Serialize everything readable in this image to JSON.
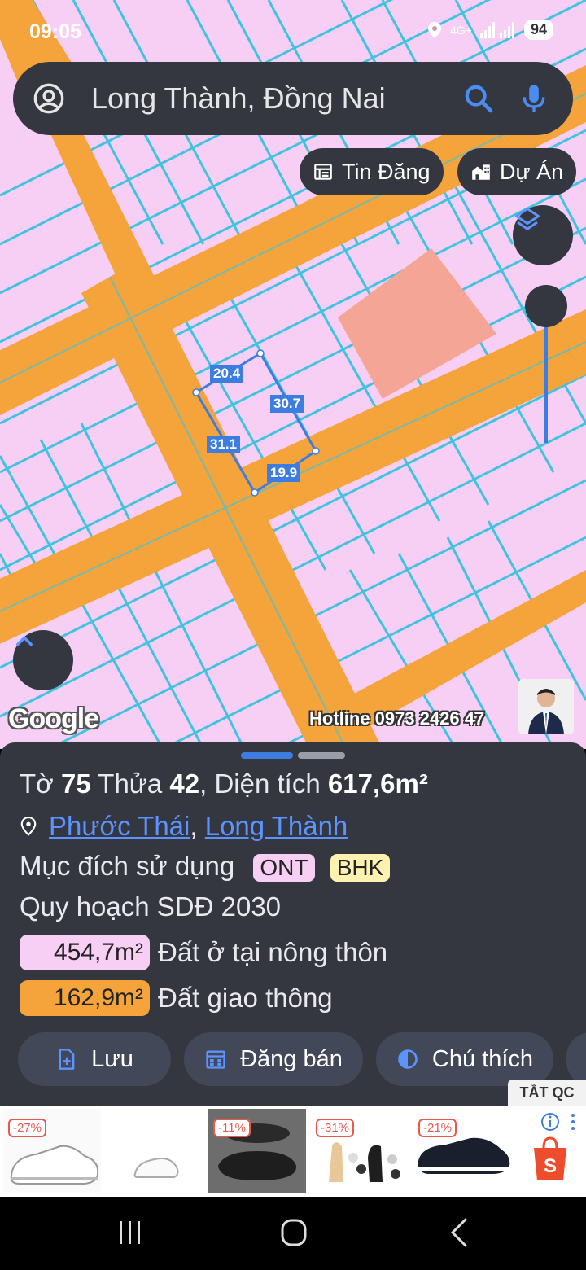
{
  "status_bar": {
    "time": "09:05",
    "network": "4G+",
    "battery": "94"
  },
  "search": {
    "query": "Long Thành, Đồng Nai"
  },
  "chips": {
    "listings": "Tin Đăng",
    "projects": "Dự Án"
  },
  "measurements": [
    "20.4",
    "30.7",
    "31.1",
    "19.9"
  ],
  "map_attribution": {
    "google": "Google",
    "hotline": "Hotline 0973 2426 47"
  },
  "parcel": {
    "to_label": "Tờ",
    "to_value": "75",
    "thua_label": "Thửa",
    "thua_value": "42",
    "area_label": ", Diện tích",
    "area_value": "617,6m²",
    "ward": "Phước Thái",
    "district": "Long Thành",
    "purpose_label": "Mục đích sử dụng",
    "purpose_tags": [
      "ONT",
      "BHK"
    ],
    "plan_label": "Quy hoạch SDĐ 2030",
    "zones": [
      {
        "area": "454,7m²",
        "label": "Đất ở tại nông thôn",
        "color": "#f7cff4"
      },
      {
        "area": "162,9m²",
        "label": "Đất giao thông",
        "color": "#f4a43a"
      }
    ]
  },
  "actions": {
    "save": "Lưu",
    "post": "Đăng bán",
    "legend": "Chú thích"
  },
  "ads": {
    "close_label": "TẮT QC",
    "discounts": [
      "-27%",
      "-11%",
      "-31%",
      "-21%"
    ]
  },
  "colors": {
    "map_bg": "#f7cff4",
    "road": "#f4a43a",
    "parcel_line": "#3ec4e0",
    "accent": "#3e7de0",
    "panel": "#34373f",
    "link": "#5b93ff"
  }
}
